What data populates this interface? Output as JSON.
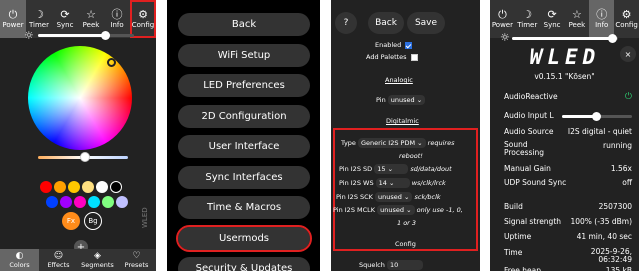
{
  "panel1": {
    "topbar": [
      {
        "icon": "power-icon",
        "glyph": "⏻",
        "label": "Power",
        "active": true
      },
      {
        "icon": "moon-icon",
        "glyph": "☽",
        "label": "Timer"
      },
      {
        "icon": "sync-icon",
        "glyph": "⟳",
        "label": "Sync"
      },
      {
        "icon": "star-icon",
        "glyph": "☆",
        "label": "Peek"
      },
      {
        "icon": "info-icon",
        "glyph": "ⓘ",
        "label": "Info"
      },
      {
        "icon": "gear-icon",
        "glyph": "⚙",
        "label": "Config"
      }
    ],
    "brightness": 0.7,
    "swatches_row1": [
      "#ff0000",
      "#ffa000",
      "#ffc800",
      "#ffe080",
      "#ffffff",
      "#000000"
    ],
    "swatches_row2": [
      "#0040ff",
      "#a000ff",
      "#ff00c0",
      "#00e0ff",
      "#80ff80",
      "#c0c0ff"
    ],
    "fx_label": "Fx",
    "bg_label": "Bg",
    "add_label": "+",
    "side_text": "WLED",
    "bottombar": [
      {
        "icon": "palette-icon",
        "glyph": "◐",
        "label": "Colors",
        "active": true
      },
      {
        "icon": "smile-icon",
        "glyph": "☺",
        "label": "Effects"
      },
      {
        "icon": "layers-icon",
        "glyph": "◈",
        "label": "Segments"
      },
      {
        "icon": "heart-icon",
        "glyph": "♡",
        "label": "Presets"
      }
    ]
  },
  "panel2": {
    "items": [
      "Back",
      "WiFi Setup",
      "LED Preferences",
      "2D Configuration",
      "User Interface",
      "Sync Interfaces",
      "Time & Macros",
      "Usermods",
      "Security & Updates"
    ]
  },
  "panel3": {
    "help": "?",
    "back": "Back",
    "save": "Save",
    "enabled_label": "Enabled",
    "add_palettes_label": "Add Palettes",
    "analogic": "Analogic",
    "pin_label": "Pin",
    "pin_value": "unused",
    "digitalmic": "Digitalmic",
    "type_label": "Type",
    "type_value": "Generic I2S PDM",
    "requires": "requires",
    "reboot": "reboot!",
    "sd_label": "Pin I2S SD",
    "sd_value": "15",
    "sd_hint": "sd/data/dout",
    "ws_label": "Pin I2S WS",
    "ws_value": "14",
    "ws_hint": "ws/clk/lrck",
    "sck_label": "Pin I2S SCK",
    "sck_value": "unused",
    "sck_hint": "sck/bclk",
    "mclk_label": "Pin I2S MCLK",
    "mclk_value": "unused",
    "mclk_hint": "only use -1, 0,",
    "mclk_hint2": "1 or 3",
    "config": "Config",
    "squelch_label": "Squelch",
    "squelch_value": "10"
  },
  "panel4": {
    "topbar": [
      {
        "icon": "power-icon",
        "glyph": "⏻",
        "label": "Power"
      },
      {
        "icon": "moon-icon",
        "glyph": "☽",
        "label": "Timer"
      },
      {
        "icon": "sync-icon",
        "glyph": "⟳",
        "label": "Sync"
      },
      {
        "icon": "star-icon",
        "glyph": "☆",
        "label": "Peek"
      },
      {
        "icon": "info-icon",
        "glyph": "ⓘ",
        "label": "Info",
        "active": true
      },
      {
        "icon": "gear-icon",
        "glyph": "⚙",
        "label": "Config"
      }
    ],
    "logo": "WLED",
    "version": "v0.15.1 \"Kōsen\"",
    "close": "×",
    "rows": [
      {
        "label": "AudioReactive",
        "value": "⏻",
        "kind": "power"
      },
      {
        "label": "Audio Input L",
        "value": "",
        "kind": "slider"
      },
      {
        "label": "Audio Source",
        "value": "I2S digital - quiet"
      },
      {
        "label": "Sound Processing",
        "value": "running"
      },
      {
        "label": "Manual Gain",
        "value": "1.56x"
      },
      {
        "label": "UDP Sound Sync",
        "value": "off"
      },
      {
        "label": "Build",
        "value": "2507300"
      },
      {
        "label": "Signal strength",
        "value": "100% (-35 dBm)"
      },
      {
        "label": "Uptime",
        "value": "41 min, 40 sec"
      },
      {
        "label": "Time",
        "value": "2025-9-26, 06:32:49"
      },
      {
        "label": "Free heap",
        "value": "135 kB"
      }
    ]
  }
}
